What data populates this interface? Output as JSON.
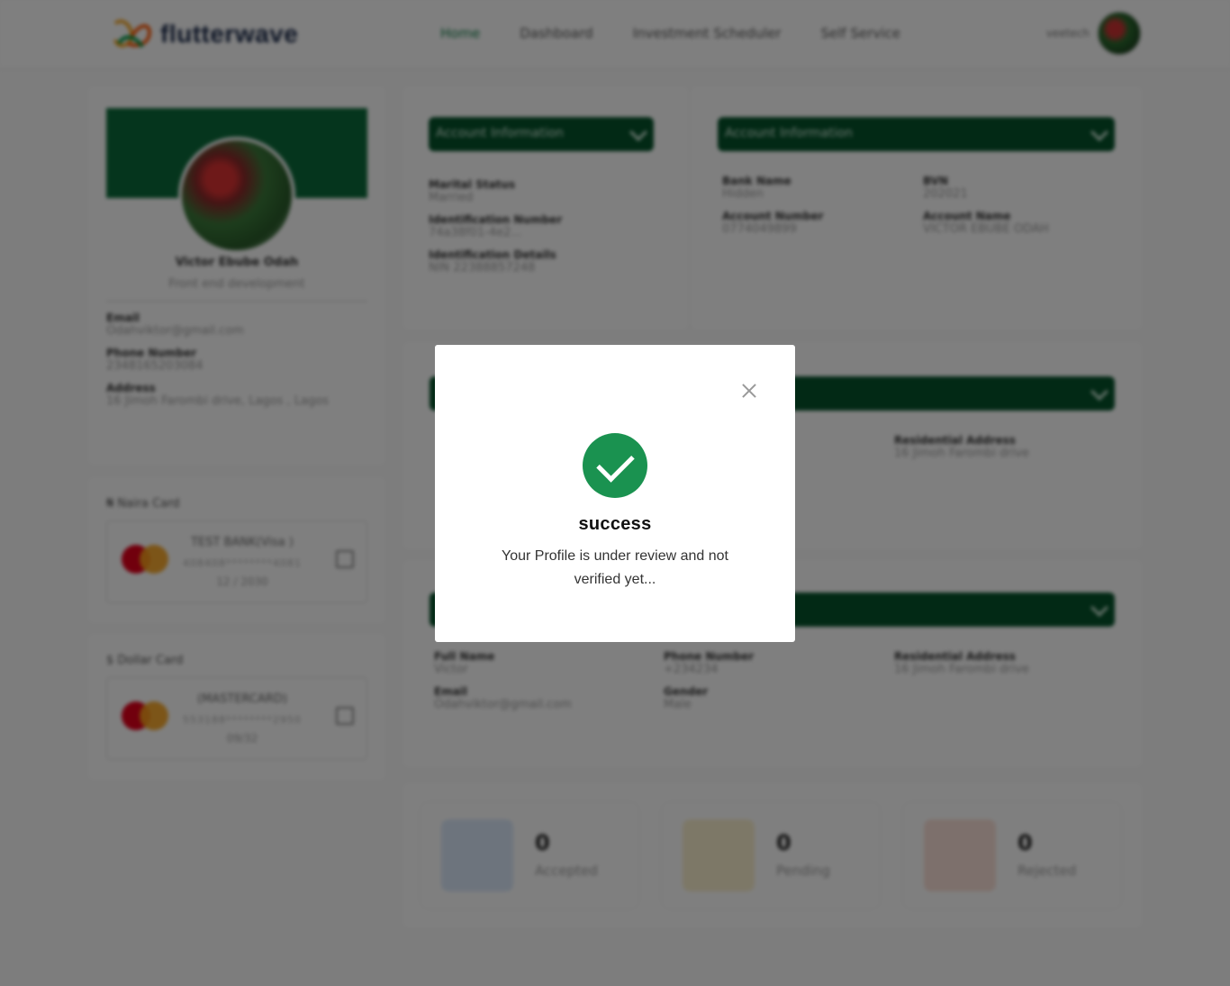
{
  "brand": {
    "name": "flutterwave"
  },
  "nav": {
    "items": [
      "Home",
      "Dashboard",
      "Investment Scheduler",
      "Self Service"
    ]
  },
  "user": {
    "username": "veetech"
  },
  "profile": {
    "name": "Victor Ebube Odah",
    "role": "Front end development",
    "email_label": "Email",
    "email": "Odahviktor@gmail.com",
    "phone_label": "Phone Number",
    "phone": "2348165203084",
    "address_label": "Address",
    "address": "16 Jimoh Farombi drive, Lagos , Lagos"
  },
  "naira_card": {
    "title": "₦ Naira Card",
    "bank": "TEST BANK(Visa )",
    "number": "408408********4081",
    "expiry": "12 / 2030"
  },
  "dollar_card": {
    "title": "$ Dollar Card",
    "bank": "(MASTERCARD)",
    "number": "553188********2950",
    "expiry": "09/32"
  },
  "account_info_a": {
    "title": "Account Information",
    "marital_label": "Marital Status",
    "marital": "Married",
    "id_number_label": "Identification Number",
    "id_number": "74a38f01-4e2...",
    "id_details_label": "Identification Details",
    "id_details": "NIN 22388857248"
  },
  "account_info_b": {
    "title": "Account Information",
    "bank_name_label": "Bank Name",
    "bank_name": "Hidden",
    "bvn_label": "BVN",
    "bvn": "202021",
    "account_number_label": "Account Number",
    "account_number": "0774049899",
    "account_name_label": "Account Name",
    "account_name": "VICTOR EBUBE ODAH"
  },
  "section_mid": {
    "residential_label": "Residential Address",
    "residential": "16 Jimoh Farombi drive"
  },
  "next_of_kin": {
    "full_name_label": "Full Name",
    "full_name": "Victor",
    "phone_label": "Phone Number",
    "phone": "+234234",
    "residential_label": "Residential Address",
    "residential": "16 Jimoh Farombi drive",
    "email_label": "Email",
    "email": "Odahviktor@gmail.com",
    "gender_label": "Gender",
    "gender": "Male"
  },
  "stats": [
    {
      "count": "0",
      "label": "Accepted",
      "color": "#dbe9fb",
      "icon": "checkbox-icon"
    },
    {
      "count": "0",
      "label": "Pending",
      "color": "#fbf1cf",
      "icon": "pending-icon"
    },
    {
      "count": "0",
      "label": "Rejected",
      "color": "#fbe1d8",
      "icon": "bell-off-icon"
    }
  ],
  "modal": {
    "title": "success",
    "message": "Your Profile is under review and not verified yet...",
    "accent": "#1a9250"
  }
}
